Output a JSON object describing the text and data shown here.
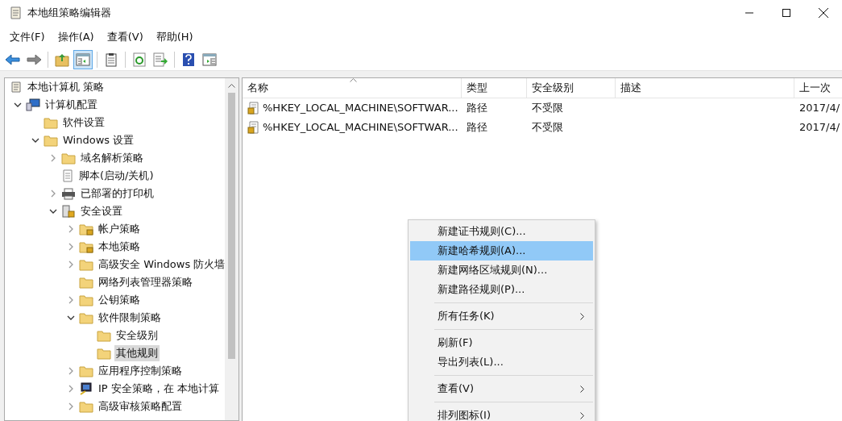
{
  "window": {
    "title": "本地组策略编辑器"
  },
  "menu_bar": [
    "文件(F)",
    "操作(A)",
    "查看(V)",
    "帮助(H)"
  ],
  "toolbar": [
    {
      "kind": "back",
      "on": false
    },
    {
      "kind": "forward",
      "on": false
    },
    {
      "kind": "separator"
    },
    {
      "kind": "up",
      "on": false
    },
    {
      "kind": "tree",
      "on": true
    },
    {
      "kind": "separator"
    },
    {
      "kind": "clipboard",
      "on": false
    },
    {
      "kind": "separator"
    },
    {
      "kind": "refresh",
      "on": false
    },
    {
      "kind": "export",
      "on": false
    },
    {
      "kind": "separator"
    },
    {
      "kind": "help",
      "on": false
    },
    {
      "kind": "pane",
      "on": false
    }
  ],
  "tree": [
    {
      "label": "本地计算机 策略",
      "kind": "scroll",
      "selected": false,
      "children": [
        {
          "label": "计算机配置",
          "kind": "computer",
          "expanded": true,
          "selected": false,
          "children": [
            {
              "label": "软件设置",
              "kind": "folder",
              "selected": false
            },
            {
              "label": "Windows 设置",
              "kind": "folder",
              "expanded": true,
              "selected": false,
              "children": [
                {
                  "label": "域名解析策略",
                  "kind": "folder",
                  "expanded": false,
                  "selected": false
                },
                {
                  "label": "脚本(启动/关机)",
                  "kind": "script",
                  "selected": false
                },
                {
                  "label": "已部署的打印机",
                  "kind": "printer",
                  "expanded": false,
                  "selected": false
                },
                {
                  "label": "安全设置",
                  "kind": "security",
                  "expanded": true,
                  "selected": false,
                  "children": [
                    {
                      "label": "帐户策略",
                      "kind": "lockfolder",
                      "expanded": false,
                      "selected": false
                    },
                    {
                      "label": "本地策略",
                      "kind": "lockfolder",
                      "expanded": false,
                      "selected": false
                    },
                    {
                      "label": "高级安全 Windows 防火墙",
                      "kind": "folder",
                      "expanded": false,
                      "selected": false
                    },
                    {
                      "label": "网络列表管理器策略",
                      "kind": "folder",
                      "selected": false
                    },
                    {
                      "label": "公钥策略",
                      "kind": "folder",
                      "expanded": false,
                      "selected": false
                    },
                    {
                      "label": "软件限制策略",
                      "kind": "folder",
                      "expanded": true,
                      "selected": false,
                      "children": [
                        {
                          "label": "安全级别",
                          "kind": "folder",
                          "selected": false
                        },
                        {
                          "label": "其他规则",
                          "kind": "folder",
                          "selected": true
                        }
                      ]
                    },
                    {
                      "label": "应用程序控制策略",
                      "kind": "folder",
                      "expanded": false,
                      "selected": false
                    },
                    {
                      "label": "IP 安全策略，在 本地计算",
                      "kind": "ipsec",
                      "expanded": false,
                      "selected": false
                    },
                    {
                      "label": "高级审核策略配置",
                      "kind": "folder",
                      "expanded": false,
                      "selected": false
                    }
                  ]
                }
              ]
            }
          ]
        }
      ]
    }
  ],
  "table": {
    "columns": [
      "名称",
      "类型",
      "安全级别",
      "描述",
      "上一次"
    ],
    "rows": [
      {
        "name": "%HKEY_LOCAL_MACHINE\\SOFTWAR...",
        "type": "路径",
        "level": "不受限",
        "date": "2017/4/"
      },
      {
        "name": "%HKEY_LOCAL_MACHINE\\SOFTWAR...",
        "type": "路径",
        "level": "不受限",
        "date": "2017/4/"
      }
    ]
  },
  "context_menu": [
    {
      "kind": "item",
      "label": "新建证书规则(C)...",
      "selected": false,
      "submenu": false
    },
    {
      "kind": "item",
      "label": "新建哈希规则(A)...",
      "selected": true,
      "submenu": false
    },
    {
      "kind": "item",
      "label": "新建网络区域规则(N)...",
      "selected": false,
      "submenu": false
    },
    {
      "kind": "item",
      "label": "新建路径规则(P)...",
      "selected": false,
      "submenu": false
    },
    {
      "kind": "separator"
    },
    {
      "kind": "item",
      "label": "所有任务(K)",
      "selected": false,
      "submenu": true
    },
    {
      "kind": "separator"
    },
    {
      "kind": "item",
      "label": "刷新(F)",
      "selected": false,
      "submenu": false
    },
    {
      "kind": "item",
      "label": "导出列表(L)...",
      "selected": false,
      "submenu": false
    },
    {
      "kind": "separator"
    },
    {
      "kind": "item",
      "label": "查看(V)",
      "selected": false,
      "submenu": true
    },
    {
      "kind": "separator"
    },
    {
      "kind": "item",
      "label": "排列图标(I)",
      "selected": false,
      "submenu": true
    }
  ]
}
